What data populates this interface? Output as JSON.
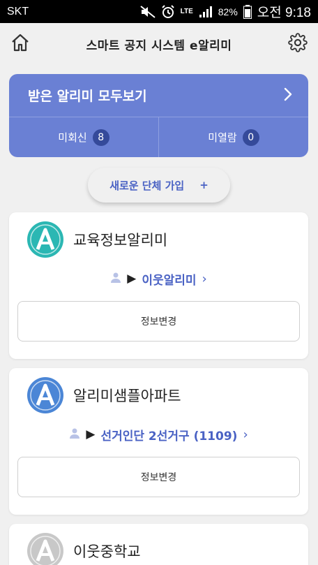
{
  "status_bar": {
    "carrier": "SKT",
    "network": "LTE",
    "battery": "82%",
    "time": "오전 9:18"
  },
  "header": {
    "title": "스마트 공지 시스템 e알리미"
  },
  "summary": {
    "title": "받은 알리미 모두보기",
    "unread_label": "미회신",
    "unread_count": "8",
    "unviewed_label": "미열람",
    "unviewed_count": "0"
  },
  "join": {
    "label": "새로운 단체 가입",
    "plus": "+"
  },
  "groups": [
    {
      "name": "교육정보알리미",
      "member": "이웃알리미",
      "change_label": "정보변경",
      "logo_color": "#2bb7b3"
    },
    {
      "name": "알리미샘플아파트",
      "member": "선거인단 2선거구 (1109)",
      "change_label": "정보변경",
      "logo_color": "#4b86d6"
    },
    {
      "name": "이웃중학교",
      "logo_color": "#c8c8c8"
    }
  ],
  "colors": {
    "accent": "#6a80d4",
    "link": "#4a62c4",
    "badge": "#354a9a"
  },
  "icons": [
    "home-icon",
    "gear-icon",
    "chevron-right-icon",
    "user-icon",
    "mute-icon",
    "alarm-icon",
    "signal-icon",
    "battery-icon"
  ]
}
